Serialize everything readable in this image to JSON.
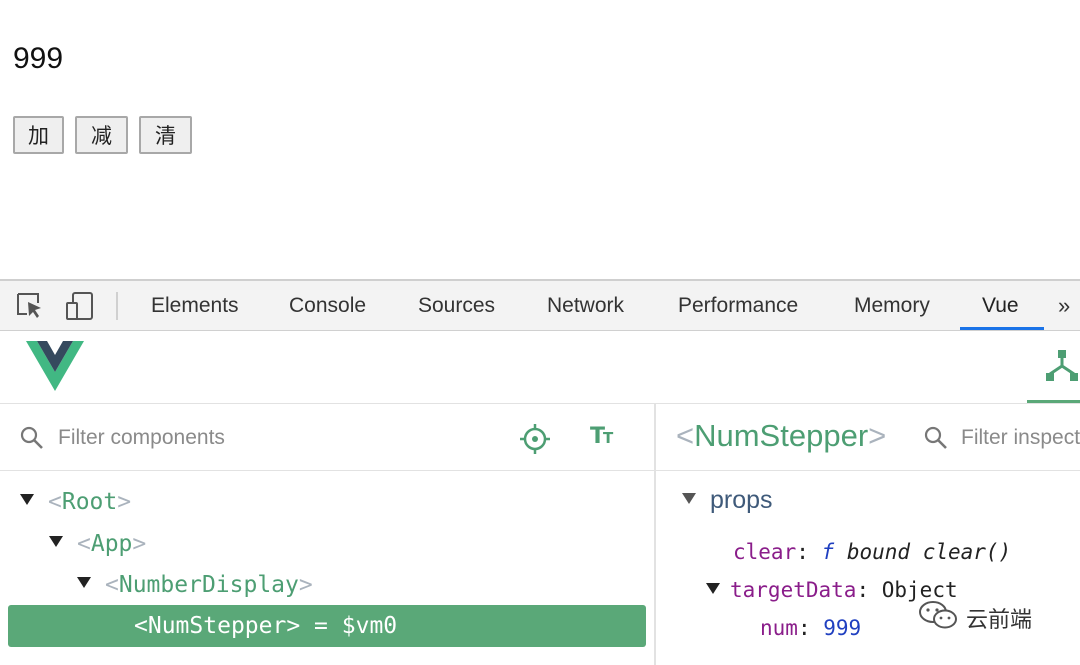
{
  "app": {
    "counter_value": "999",
    "buttons": {
      "add": "加",
      "subtract": "减",
      "clear": "清"
    }
  },
  "devtools": {
    "tabs": [
      "Elements",
      "Console",
      "Sources",
      "Network",
      "Performance",
      "Memory",
      "Vue"
    ],
    "active_tab": "Vue",
    "more": "»",
    "accent_color": "#1a73e8"
  },
  "vue": {
    "brand_color": "#4d9e73",
    "filter_components_placeholder": "Filter components",
    "tree": {
      "root": "Root",
      "app": "App",
      "number_display": "NumberDisplay",
      "selected": "NumStepper",
      "selected_suffix": " = $vm0",
      "open_bracket": "<",
      "close_bracket": ">"
    },
    "inspector": {
      "component_name": "NumStepper",
      "filter_placeholder": "Filter inspected data",
      "section": "props",
      "clear_key": "clear",
      "clear_f": "f",
      "clear_value": "bound clear()",
      "target_key": "targetData",
      "target_value": "Object",
      "num_key": "num",
      "num_value": "999",
      "colon": ":"
    }
  },
  "watermark": {
    "text": "云前端"
  }
}
